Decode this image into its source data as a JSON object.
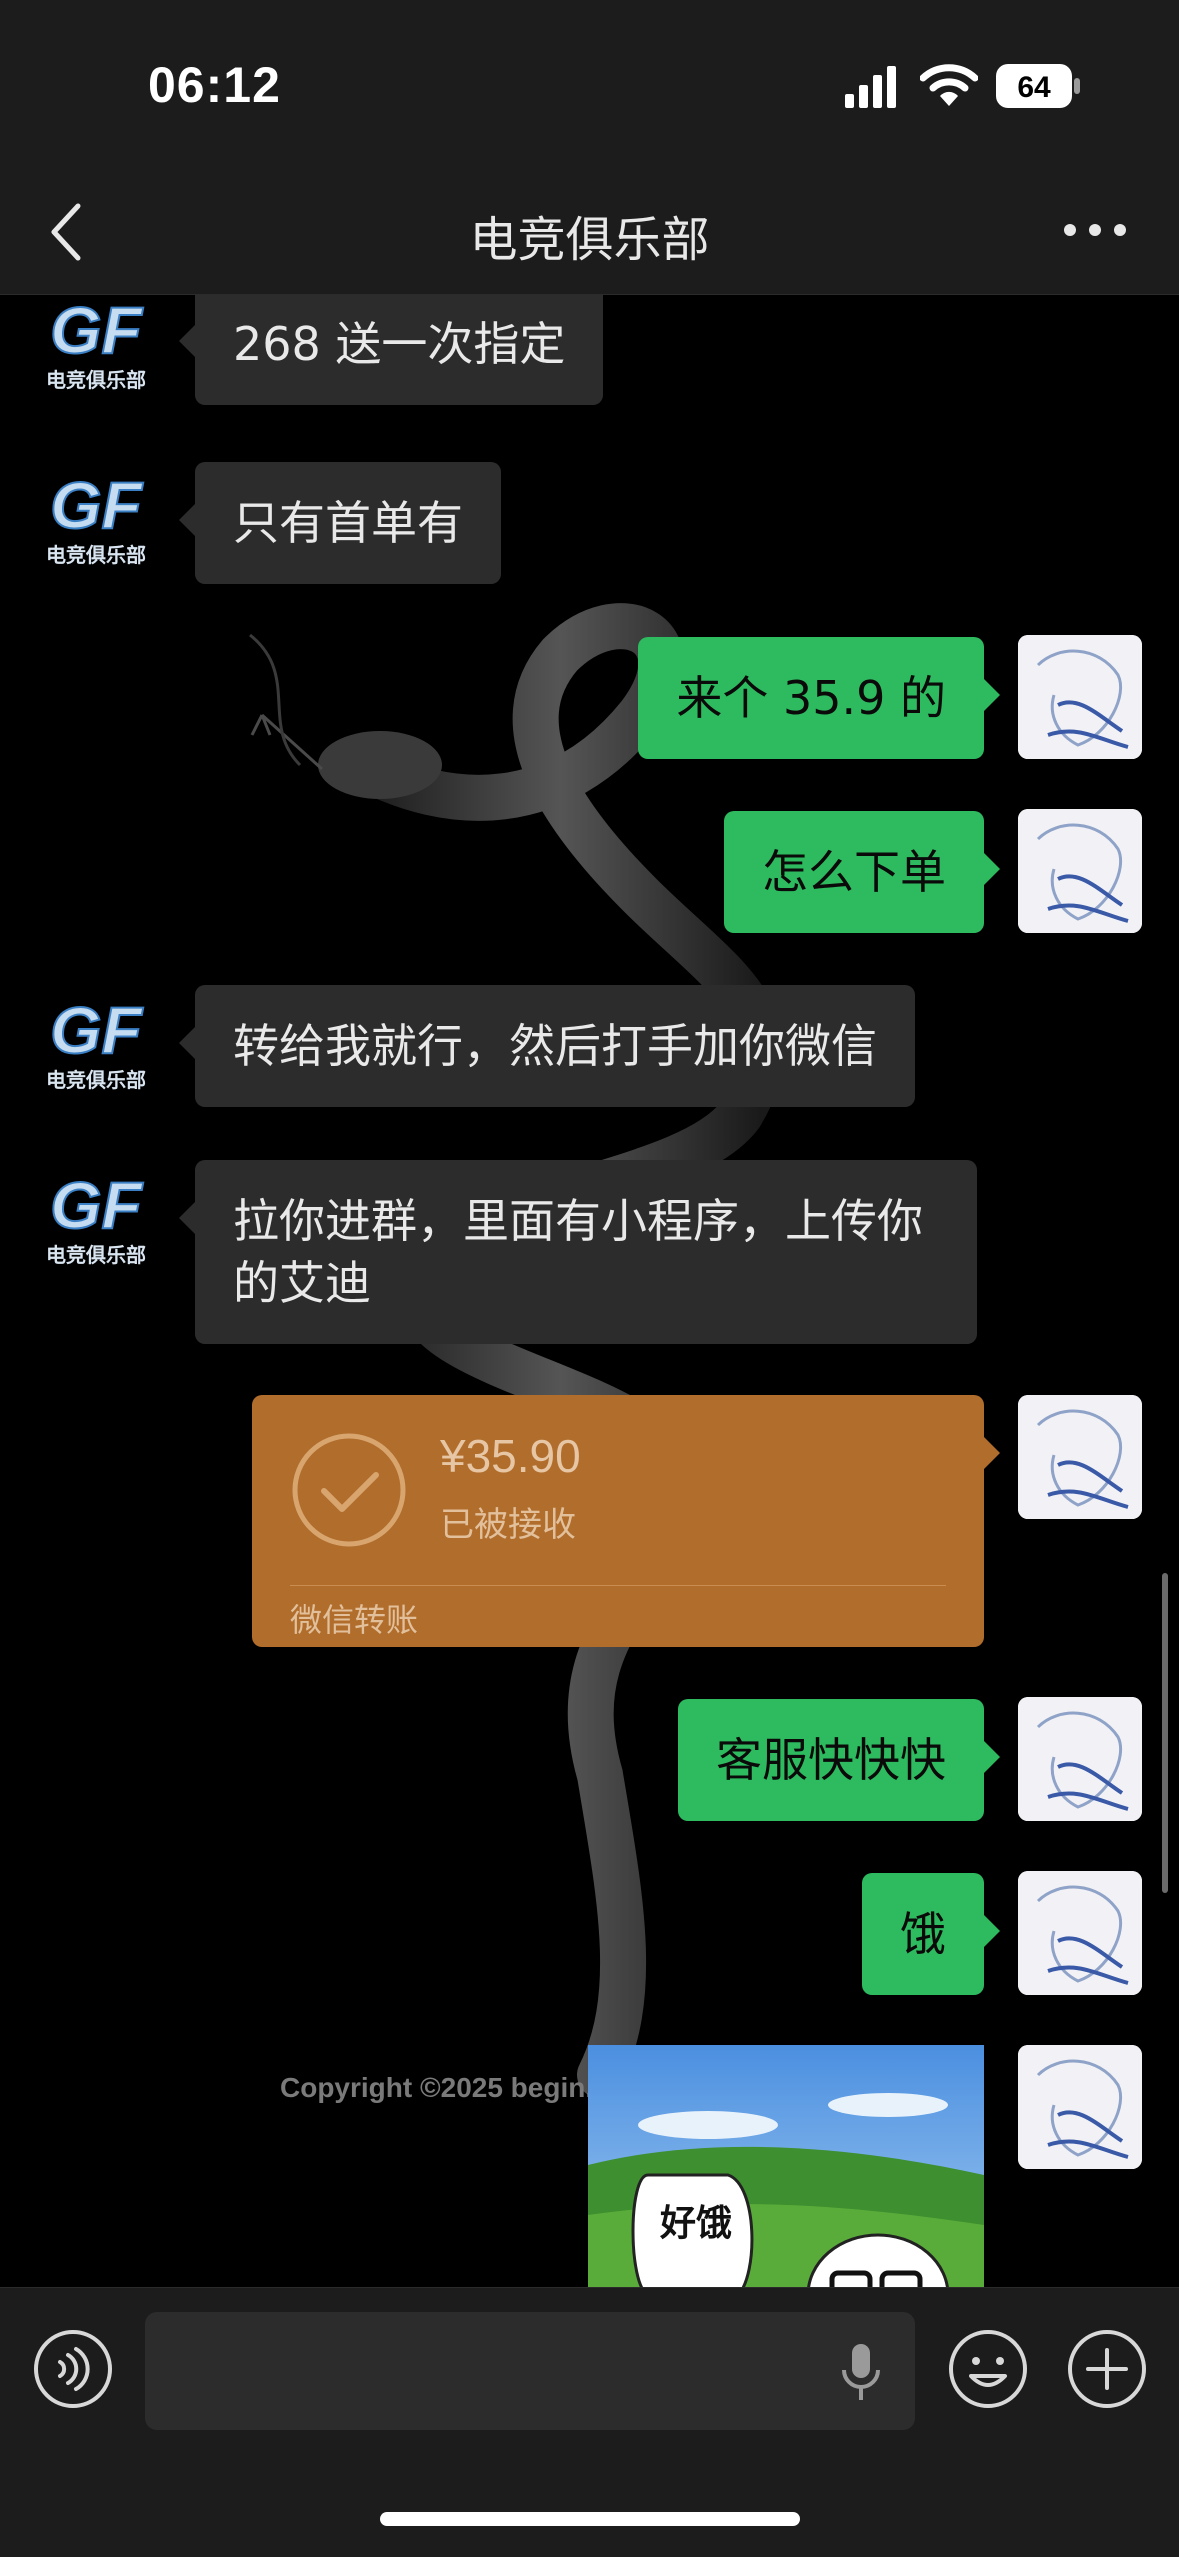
{
  "status_bar": {
    "time": "06:12",
    "battery": "64"
  },
  "header": {
    "title": "电竞俱乐部"
  },
  "avatar_text": {
    "line1": "GF",
    "line2": "电竞俱乐部"
  },
  "messages": [
    {
      "sender": "other",
      "text": "268 送一次指定"
    },
    {
      "sender": "other",
      "text": "只有首单有"
    },
    {
      "sender": "me",
      "text": "来个 35.9 的"
    },
    {
      "sender": "me",
      "text": "怎么下单"
    },
    {
      "sender": "other",
      "text": "转给我就行，然后打手加你微信"
    },
    {
      "sender": "other",
      "text": "拉你进群，里面有小程序，上传你的艾迪"
    },
    {
      "sender": "me",
      "type": "transfer",
      "amount": "¥35.90",
      "status": "已被接收",
      "label": "微信转账"
    },
    {
      "sender": "me",
      "text": "客服快快快"
    },
    {
      "sender": "me",
      "text": "饿"
    },
    {
      "sender": "me",
      "type": "sticker",
      "sticker_text": "好饿"
    }
  ],
  "background": {
    "copyright": "Copyright ©2025 begin."
  },
  "input_bar": {
    "placeholder": ""
  },
  "colors": {
    "out_bubble": "#2ebb5f",
    "in_bubble": "#2c2c2c",
    "transfer": "#b06d2c",
    "bars": "#1c1c1c"
  }
}
